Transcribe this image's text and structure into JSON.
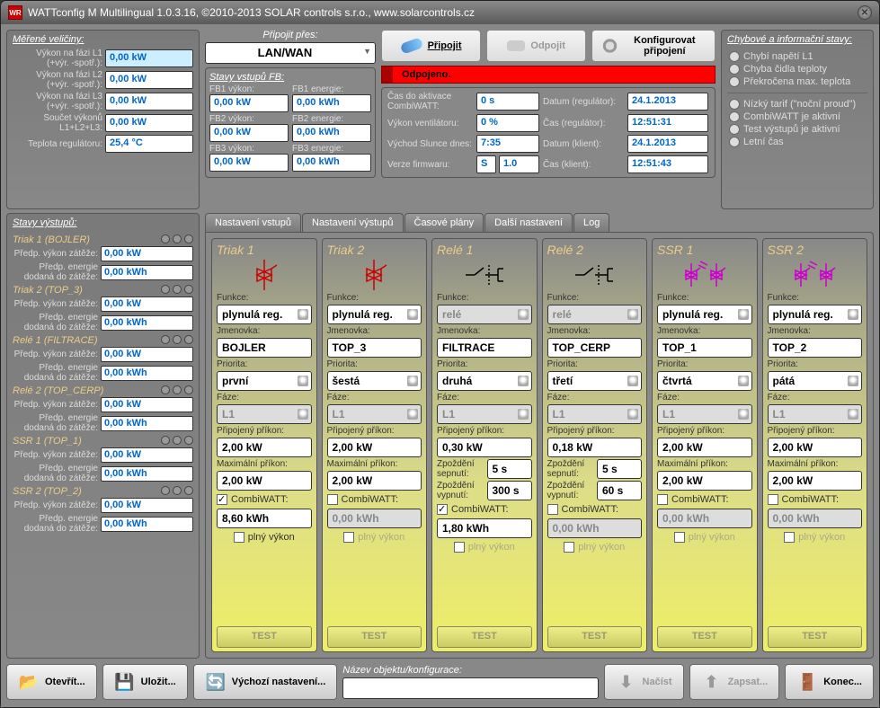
{
  "titlebar": "WATTconfig M  Multilingual 1.0.3.16,  ©2010-2013 SOLAR controls s.r.o.,  www.solarcontrols.cz",
  "measured": {
    "title": "Měřené veličiny:",
    "rows": [
      {
        "label": "Výkon na fázi L1 (+výr. -spotř.):",
        "val": "0,00 kW",
        "hl": true
      },
      {
        "label": "Výkon na fázi L2 (+výr. -spotř.):",
        "val": "0,00 kW"
      },
      {
        "label": "Výkon na fázi L3 (+výr. -spotř.):",
        "val": "0,00 kW"
      },
      {
        "label": "Součet výkonů L1+L2+L3:",
        "val": "0,00 kW"
      },
      {
        "label": "Teplota regulátoru:",
        "val": "25,4 °C"
      }
    ]
  },
  "connect": {
    "via_label": "Připojit přes:",
    "via_value": "LAN/WAN",
    "connect_btn": "Připojit",
    "disconnect_btn": "Odpojit",
    "config_btn": "Konfigurovat připojení",
    "fb_title": "Stavy vstupů FB:",
    "fb": [
      {
        "p_label": "FB1 výkon:",
        "p_val": "0,00 kW",
        "e_label": "FB1 energie:",
        "e_val": "0,00 kWh"
      },
      {
        "p_label": "FB2 výkon:",
        "p_val": "0,00 kW",
        "e_label": "FB2 energie:",
        "e_val": "0,00 kWh"
      },
      {
        "p_label": "FB3 výkon:",
        "p_val": "0,00 kW",
        "e_label": "FB3 energie:",
        "e_val": "0,00 kWh"
      }
    ]
  },
  "status": {
    "text": "Odpojeno.",
    "info": {
      "combiwatt_label": "Čas do aktivace CombiWATT:",
      "combiwatt_val": "0 s",
      "date_reg_label": "Datum (regulátor):",
      "date_reg_val": "24.1.2013",
      "fan_label": "Výkon ventilátoru:",
      "fan_val": "0 %",
      "time_reg_label": "Čas (regulátor):",
      "time_reg_val": "12:51:31",
      "sunrise_label": "Východ Slunce dnes:",
      "sunrise_val": "7:35",
      "date_cli_label": "Datum (klient):",
      "date_cli_val": "24.1.2013",
      "fw_label": "Verze firmwaru:",
      "fw_val_s": "S",
      "fw_val_v": "1.0",
      "time_cli_label": "Čas (klient):",
      "time_cli_val": "12:51:43"
    }
  },
  "errors": {
    "title": "Chybové a informační stavy:",
    "items": [
      "Chybí napětí L1",
      "Chyba čidla teploty",
      "Překročena max. teplota"
    ],
    "info_items": [
      "Nízký tarif (\"noční proud\")",
      "CombiWATT je aktivní",
      "Test výstupů je aktivní",
      "Letní čas"
    ]
  },
  "out_states": {
    "title": "Stavy výstupů:",
    "items": [
      {
        "name": "Triak 1 (BOJLER)",
        "power": "0,00 kW",
        "energy": "0,00 kWh"
      },
      {
        "name": "Triak 2 (TOP_3)",
        "power": "0,00 kW",
        "energy": "0,00 kWh"
      },
      {
        "name": "Relé 1 (FILTRACE)",
        "power": "0,00 kW",
        "energy": "0,00 kWh"
      },
      {
        "name": "Relé 2 (TOP_CERP)",
        "power": "0,00 kW",
        "energy": "0,00 kWh"
      },
      {
        "name": "SSR 1 (TOP_1)",
        "power": "0,00 kW",
        "energy": "0,00 kWh"
      },
      {
        "name": "SSR 2 (TOP_2)",
        "power": "0,00 kW",
        "energy": "0,00 kWh"
      }
    ],
    "power_label": "Předp. výkon zátěže:",
    "energy_label": "Předp. energie dodaná do zátěže:"
  },
  "tabs": {
    "items": [
      "Nastavení vstupů",
      "Nastavení výstupů",
      "Časové plány",
      "Další nastavení",
      "Log"
    ],
    "active": 1
  },
  "out_cols": {
    "labels": {
      "func": "Funkce:",
      "name": "Jmenovka:",
      "prio": "Priorita:",
      "phase": "Fáze:",
      "conn_p": "Připojený příkon:",
      "max_p": "Maximální příkon:",
      "delay_on": "Zpoždění sepnutí:",
      "delay_off": "Zpoždění vypnutí:",
      "combiwatt": "CombiWATT:",
      "full": "plný výkon",
      "test": "TEST"
    },
    "cols": [
      {
        "title": "Triak 1",
        "icon": "triac",
        "func": "plynulá reg.",
        "name": "BOJLER",
        "prio": "první",
        "phase": "L1",
        "conn_p": "2,00 kW",
        "max_p": "2,00 kW",
        "delay_on": null,
        "delay_off": null,
        "cw_checked": true,
        "cw_val": "8,60 kWh",
        "full_checked": false,
        "full_disabled": false
      },
      {
        "title": "Triak 2",
        "icon": "triac",
        "func": "plynulá reg.",
        "name": "TOP_3",
        "prio": "šestá",
        "phase": "L1",
        "conn_p": "2,00 kW",
        "max_p": "2,00 kW",
        "delay_on": null,
        "delay_off": null,
        "cw_checked": false,
        "cw_val": "0,00 kWh",
        "full_checked": false,
        "full_disabled": true
      },
      {
        "title": "Relé 1",
        "icon": "relay",
        "func": "relé",
        "func_disabled": true,
        "name": "FILTRACE",
        "prio": "druhá",
        "phase": "L1",
        "conn_p": "0,30 kW",
        "max_p": null,
        "delay_on": "5 s",
        "delay_off": "300 s",
        "cw_checked": true,
        "cw_val": "1,80 kWh",
        "full_checked": false,
        "full_disabled": true
      },
      {
        "title": "Relé 2",
        "icon": "relay",
        "func": "relé",
        "func_disabled": true,
        "name": "TOP_CERP",
        "prio": "třetí",
        "phase": "L1",
        "conn_p": "0,18 kW",
        "max_p": null,
        "delay_on": "5 s",
        "delay_off": "60 s",
        "cw_checked": false,
        "cw_val": "0,00 kWh",
        "full_checked": false,
        "full_disabled": true
      },
      {
        "title": "SSR 1",
        "icon": "ssr",
        "func": "plynulá reg.",
        "name": "TOP_1",
        "prio": "čtvrtá",
        "phase": "L1",
        "conn_p": "2,00 kW",
        "max_p": "2,00 kW",
        "delay_on": null,
        "delay_off": null,
        "cw_checked": false,
        "cw_val": "0,00 kWh",
        "full_checked": false,
        "full_disabled": true
      },
      {
        "title": "SSR 2",
        "icon": "ssr",
        "func": "plynulá reg.",
        "name": "TOP_2",
        "prio": "pátá",
        "phase": "L1",
        "conn_p": "2,00 kW",
        "max_p": "2,00 kW",
        "delay_on": null,
        "delay_off": null,
        "cw_checked": false,
        "cw_val": "0,00 kWh",
        "full_checked": false,
        "full_disabled": true
      }
    ]
  },
  "bottom": {
    "open": "Otevřít...",
    "save": "Uložit...",
    "defaults": "Výchozí nastavení...",
    "name_label": "Název objektu/konfigurace:",
    "read": "Načíst",
    "write": "Zapsat...",
    "end": "Konec..."
  }
}
